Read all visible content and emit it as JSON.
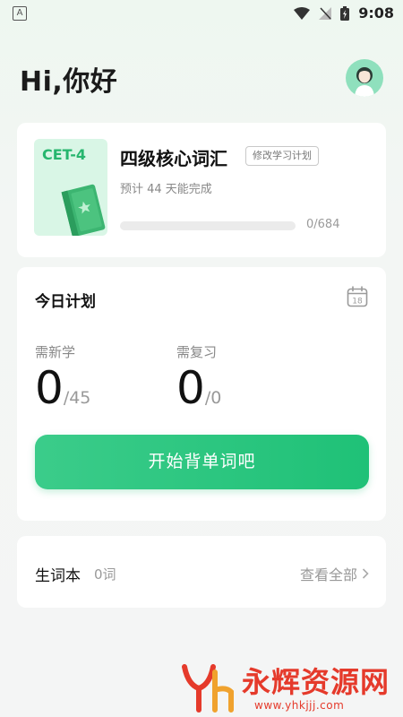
{
  "status_bar": {
    "time": "9:08",
    "left_icon": "A"
  },
  "header": {
    "greeting": "Hi,你好",
    "avatar_icon": "user-avatar-icon"
  },
  "book": {
    "cover_label": "CET-4",
    "title": "四级核心词汇",
    "edit_plan_label": "修改学习计划",
    "subtitle": "预计 44 天能完成",
    "progress_value": 0,
    "progress_total": 684,
    "progress_text": "0/684"
  },
  "plan": {
    "title": "今日计划",
    "calendar_icon_text": "18",
    "new_label": "需新学",
    "new_value": "0",
    "new_total": "/45",
    "review_label": "需复习",
    "review_value": "0",
    "review_total": "/0",
    "start_button": "开始背单词吧"
  },
  "vocab": {
    "title": "生词本",
    "count": "0词",
    "view_all": "查看全部"
  },
  "watermark": {
    "text": "永辉资源网",
    "url": "www.yhkjjj.com"
  },
  "colors": {
    "accent": "#2ec27e",
    "watermark": "#e53a2b"
  }
}
